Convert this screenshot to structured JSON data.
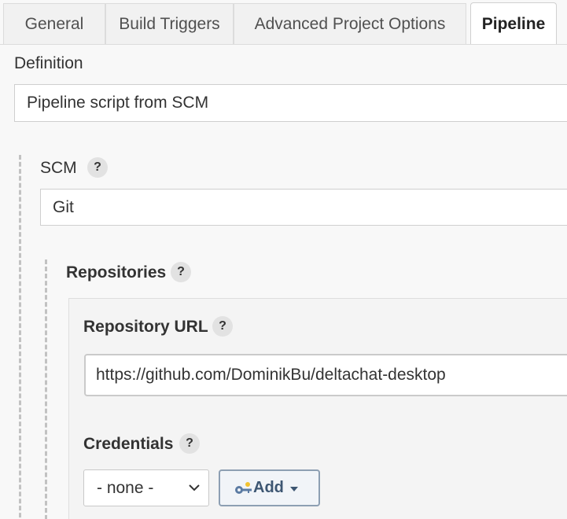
{
  "tabs": [
    {
      "label": "General"
    },
    {
      "label": "Build Triggers"
    },
    {
      "label": "Advanced Project Options"
    },
    {
      "label": "Pipeline",
      "active": true
    }
  ],
  "definition": {
    "label": "Definition",
    "value": "Pipeline script from SCM"
  },
  "scm": {
    "label": "SCM",
    "help": "?",
    "value": "Git"
  },
  "repositories": {
    "label": "Repositories",
    "help": "?",
    "repository_url": {
      "label": "Repository URL",
      "help": "?",
      "value": "https://github.com/DominikBu/deltachat-desktop"
    },
    "credentials": {
      "label": "Credentials",
      "help": "?",
      "selected": "- none -",
      "add_button": "Add",
      "add_icon": "key-icon"
    }
  },
  "colors": {
    "background": "#f8f8f8",
    "active_tab_bg": "#ffffff",
    "add_button_border": "#8d9fb3",
    "add_button_text": "#3d5672"
  }
}
